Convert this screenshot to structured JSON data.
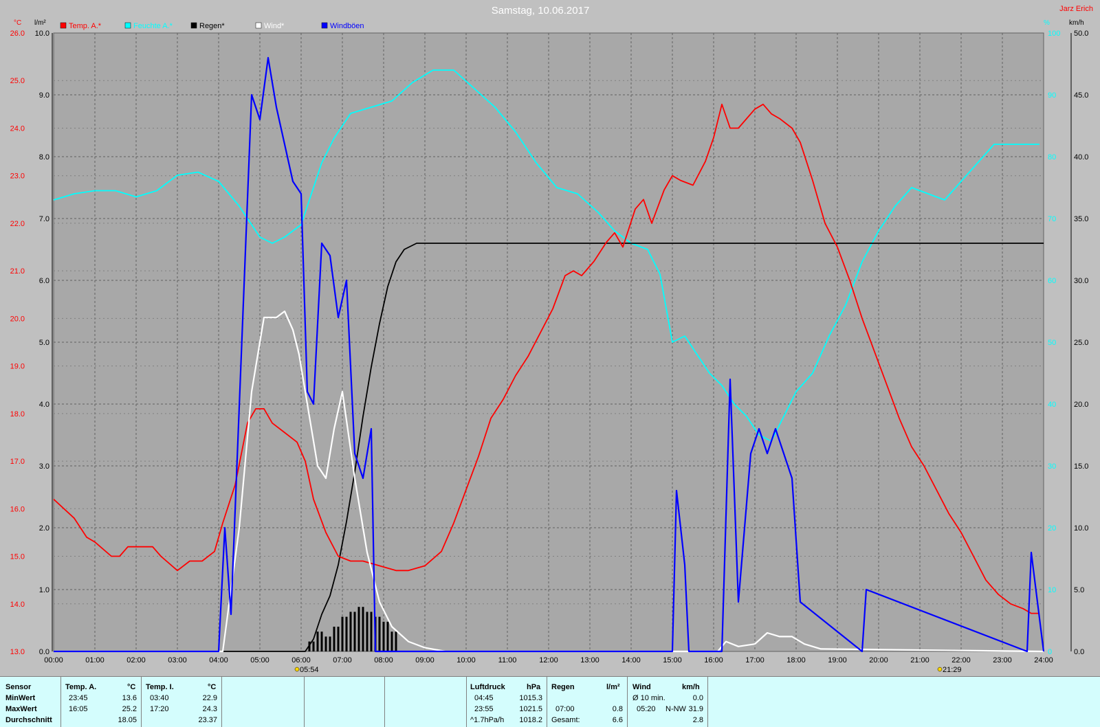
{
  "title": "Samstag, 10.06.2017",
  "author": "Jarz Erich",
  "axes": {
    "left_unit": "°C",
    "left2_unit": "l/m²",
    "right_unit": "%",
    "right2_unit": "km/h",
    "temp_ticks": [
      "26.0",
      "25.0",
      "24.0",
      "23.0",
      "22.0",
      "21.0",
      "20.0",
      "19.0",
      "18.0",
      "17.0",
      "16.0",
      "15.0",
      "14.0",
      "13.0"
    ],
    "rain_ticks": [
      "10.0",
      "9.0",
      "8.0",
      "7.0",
      "6.0",
      "5.0",
      "4.0",
      "3.0",
      "2.0",
      "1.0",
      "0.0"
    ],
    "hum_ticks": [
      "100",
      "90",
      "80",
      "70",
      "60",
      "50",
      "40",
      "30",
      "20",
      "10",
      "0"
    ],
    "wind_ticks": [
      "50.0",
      "45.0",
      "40.0",
      "35.0",
      "30.0",
      "25.0",
      "20.0",
      "15.0",
      "10.0",
      "5.0",
      "0.0"
    ],
    "time_ticks": [
      "00:00",
      "01:00",
      "02:00",
      "03:00",
      "04:00",
      "05:00",
      "06:00",
      "07:00",
      "08:00",
      "09:00",
      "10:00",
      "11:00",
      "12:00",
      "13:00",
      "14:00",
      "15:00",
      "16:00",
      "17:00",
      "18:00",
      "19:00",
      "20:00",
      "21:00",
      "22:00",
      "23:00",
      "24:00"
    ],
    "sunrise": "05:54",
    "sunset": "21:29"
  },
  "legend": [
    {
      "label": "Temp. A.*",
      "color": "#ff0000"
    },
    {
      "label": "Feuchte A.*",
      "color": "#00ffff"
    },
    {
      "label": "Regen*",
      "color": "#000000"
    },
    {
      "label": "Wind*",
      "color": "#ffffff"
    },
    {
      "label": "Windböen",
      "color": "#0000ff"
    }
  ],
  "chart_data": {
    "type": "line",
    "x_unit": "hours",
    "xlim": [
      0,
      24
    ],
    "series": [
      {
        "name": "Temp. A.*",
        "axis": "°C",
        "ylim": [
          13,
          26
        ],
        "color": "#ff0000",
        "x": [
          0,
          0.5,
          0.8,
          1,
          1.4,
          1.6,
          1.8,
          2,
          2.4,
          2.6,
          3,
          3.3,
          3.6,
          3.9,
          4.1,
          4.4,
          4.7,
          4.9,
          5.1,
          5.3,
          5.6,
          5.9,
          6.1,
          6.3,
          6.6,
          6.9,
          7.2,
          7.5,
          7.9,
          8.3,
          8.6,
          9,
          9.4,
          9.7,
          10,
          10.3,
          10.6,
          10.9,
          11.2,
          11.5,
          11.8,
          12.1,
          12.4,
          12.6,
          12.8,
          13.1,
          13.4,
          13.6,
          13.8,
          14.1,
          14.3,
          14.5,
          14.8,
          15,
          15.2,
          15.5,
          15.8,
          16,
          16.2,
          16.4,
          16.6,
          16.8,
          17,
          17.2,
          17.4,
          17.6,
          17.9,
          18.1,
          18.4,
          18.7,
          19,
          19.3,
          19.6,
          19.9,
          20.2,
          20.5,
          20.8,
          21.1,
          21.4,
          21.7,
          22,
          22.3,
          22.6,
          22.9,
          23.2,
          23.5,
          23.7,
          23.9
        ],
        "values": [
          16.2,
          15.8,
          15.4,
          15.3,
          15.0,
          15.0,
          15.2,
          15.2,
          15.2,
          15.0,
          14.7,
          14.9,
          14.9,
          15.1,
          15.7,
          16.5,
          17.8,
          18.1,
          18.1,
          17.8,
          17.6,
          17.4,
          17.0,
          16.2,
          15.5,
          15.0,
          14.9,
          14.9,
          14.8,
          14.7,
          14.7,
          14.8,
          15.1,
          15.7,
          16.4,
          17.1,
          17.9,
          18.3,
          18.8,
          19.2,
          19.7,
          20.2,
          20.9,
          21.0,
          20.9,
          21.2,
          21.6,
          21.8,
          21.5,
          22.3,
          22.5,
          22.0,
          22.7,
          23.0,
          22.9,
          22.8,
          23.3,
          23.8,
          24.5,
          24.0,
          24.0,
          24.2,
          24.4,
          24.5,
          24.3,
          24.2,
          24.0,
          23.7,
          22.9,
          22.0,
          21.5,
          20.8,
          20.0,
          19.3,
          18.6,
          17.9,
          17.3,
          16.9,
          16.4,
          15.9,
          15.5,
          15.0,
          14.5,
          14.2,
          14.0,
          13.9,
          13.8,
          13.8
        ]
      },
      {
        "name": "Feuchte A.*",
        "axis": "%",
        "ylim": [
          0,
          100
        ],
        "color": "#00ffff",
        "x": [
          0,
          0.5,
          1,
          1.5,
          2,
          2.5,
          3,
          3.5,
          4,
          4.5,
          5,
          5.3,
          5.6,
          6,
          6.2,
          6.5,
          6.8,
          7.2,
          7.7,
          8.2,
          8.7,
          9.2,
          9.7,
          10.2,
          10.7,
          11.2,
          11.7,
          12.2,
          12.7,
          13.2,
          13.6,
          14,
          14.4,
          14.7,
          15,
          15.3,
          15.6,
          15.9,
          16.2,
          16.5,
          16.8,
          17.1,
          17.4,
          17.7,
          18,
          18.4,
          18.8,
          19.2,
          19.6,
          20,
          20.4,
          20.8,
          21.2,
          21.6,
          22,
          22.4,
          22.8,
          23.2,
          23.6,
          23.9
        ],
        "values": [
          73,
          74,
          74.5,
          74.5,
          73.5,
          74.5,
          77,
          77.5,
          76,
          72,
          67,
          66,
          67,
          69,
          73,
          79,
          83,
          87,
          88,
          89,
          92,
          94,
          94,
          91,
          88,
          84,
          79,
          75,
          74,
          71,
          68,
          66,
          65,
          61,
          50,
          51,
          48,
          45,
          43,
          40,
          38,
          35,
          34,
          38,
          42,
          45,
          51,
          56,
          63,
          68,
          72,
          75,
          74,
          73,
          76,
          79,
          82,
          82,
          82,
          82
        ]
      },
      {
        "name": "Regen*",
        "axis": "l/m²",
        "ylim": [
          0,
          10
        ],
        "color": "#000000",
        "x": [
          0,
          6.1,
          6.3,
          6.5,
          6.7,
          6.9,
          7.1,
          7.3,
          7.5,
          7.7,
          7.9,
          8.1,
          8.3,
          8.5,
          8.8,
          9.2,
          9.6,
          10,
          24
        ],
        "values": [
          0,
          0,
          0.2,
          0.6,
          0.9,
          1.4,
          2.1,
          2.9,
          3.8,
          4.6,
          5.3,
          5.9,
          6.3,
          6.5,
          6.6,
          6.6,
          6.6,
          6.6,
          6.6
        ]
      },
      {
        "name": "Wind*",
        "axis": "km/h",
        "ylim": [
          0,
          50
        ],
        "color": "#ffffff",
        "x": [
          0,
          4.1,
          4.5,
          4.8,
          5.1,
          5.4,
          5.6,
          5.8,
          5.95,
          6.05,
          6.2,
          6.4,
          6.6,
          6.8,
          7,
          7.3,
          7.6,
          7.9,
          8.2,
          8.6,
          9,
          9.5,
          16.1,
          16.3,
          16.6,
          17,
          17.3,
          17.6,
          17.9,
          18.2,
          18.6,
          24
        ],
        "values": [
          0,
          0,
          10,
          21,
          27,
          27,
          27.5,
          26,
          24,
          22,
          19,
          15,
          14,
          18,
          21,
          14,
          8,
          4,
          2,
          0.8,
          0.3,
          0,
          0,
          0.8,
          0.4,
          0.6,
          1.5,
          1.2,
          1.2,
          0.6,
          0.2,
          0
        ]
      },
      {
        "name": "Windböen",
        "axis": "km/h",
        "ylim": [
          0,
          50
        ],
        "color": "#0000ff",
        "x": [
          0,
          4.0,
          4.15,
          4.3,
          4.8,
          5.0,
          5.2,
          5.4,
          5.6,
          5.8,
          6.0,
          6.15,
          6.3,
          6.5,
          6.7,
          6.9,
          7.1,
          7.3,
          7.5,
          7.7,
          7.8,
          7.9,
          8.0,
          15.0,
          15.1,
          15.3,
          15.4,
          16.2,
          16.4,
          16.6,
          16.9,
          17.1,
          17.3,
          17.5,
          17.7,
          17.9,
          18.1,
          19.6,
          19.7,
          23.6,
          23.7,
          24
        ],
        "values": [
          0,
          0,
          10,
          3,
          45,
          43,
          48,
          44,
          41,
          38,
          37,
          21,
          20,
          33,
          32,
          27,
          30,
          16,
          14,
          18,
          0,
          0,
          0,
          0,
          13,
          7,
          0,
          0,
          22,
          4,
          16,
          18,
          16,
          18,
          16,
          14,
          4,
          0,
          5,
          0,
          8,
          0
        ]
      }
    ]
  },
  "table": {
    "row_labels": [
      "Sensor",
      "MinWert",
      "MaxWert",
      "Durchschnitt"
    ],
    "temp_a": {
      "header": "Temp. A.",
      "unit": "°C",
      "min_time": "23:45",
      "min": "13.6",
      "max_time": "16:05",
      "max": "25.2",
      "avg": "18.05"
    },
    "temp_i": {
      "header": "Temp. I.",
      "unit": "°C",
      "min_time": "03:40",
      "min": "22.9",
      "max_time": "17:20",
      "max": "24.3",
      "avg": "23.37"
    },
    "pressure": {
      "header": "Luftdruck",
      "unit": "hPa",
      "min_time": "04:45",
      "min": "1015.3",
      "max_time": "23:55",
      "max": "1021.5",
      "trend": "^1.7hPa/h",
      "last": "1018.2"
    },
    "rain": {
      "header": "Regen",
      "unit": "l/m²",
      "max_time": "07:00",
      "max": "0.8",
      "total_label": "Gesamt:",
      "total": "6.6"
    },
    "wind": {
      "header": "Wind",
      "unit": "km/h",
      "avg_label": "Ø 10 min.",
      "avg": "0.0",
      "max_time": "05:20",
      "max_dir": "N-NW",
      "max": "31.9",
      "mean": "2.8"
    }
  }
}
